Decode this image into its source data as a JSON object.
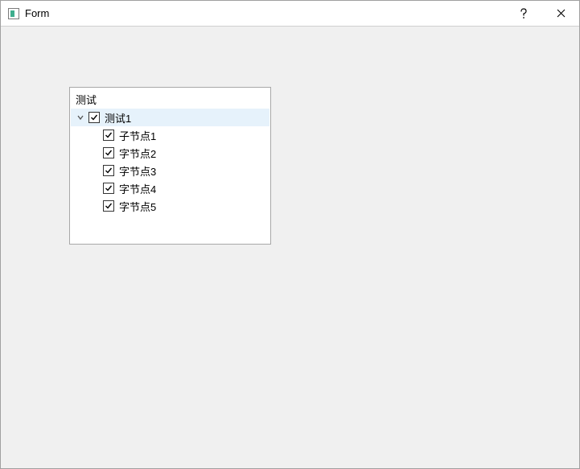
{
  "window": {
    "title": "Form"
  },
  "tree": {
    "header": "测试",
    "root": {
      "label": "测试1",
      "checked": true,
      "expanded": true,
      "selected": true,
      "children": [
        {
          "label": "子节点1",
          "checked": true
        },
        {
          "label": "字节点2",
          "checked": true
        },
        {
          "label": "字节点3",
          "checked": true
        },
        {
          "label": "字节点4",
          "checked": true
        },
        {
          "label": "字节点5",
          "checked": true
        }
      ]
    }
  }
}
